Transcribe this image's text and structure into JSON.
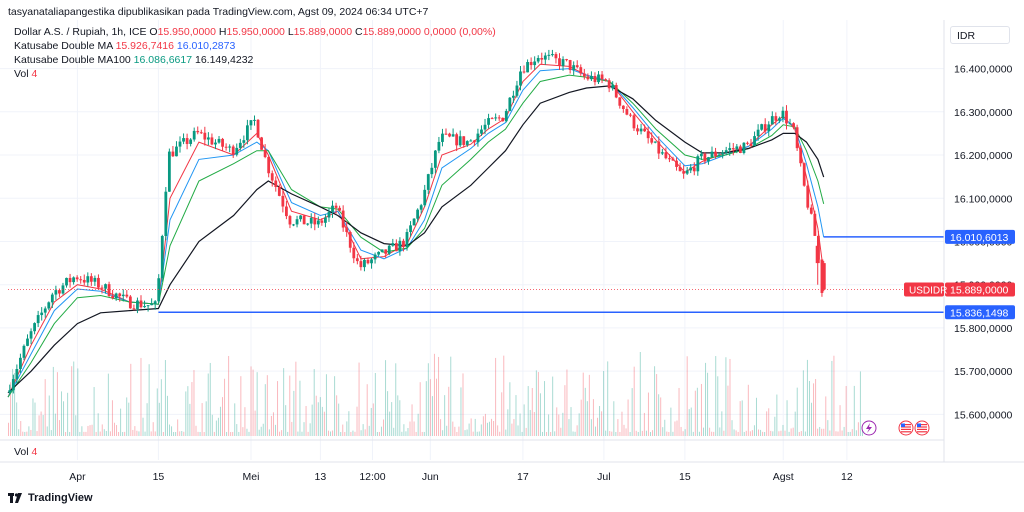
{
  "header": {
    "publisher_line": "tasyanataliapangestika dipublikasikan pada TradingView.com, Agst 09, 2024 06:34 UTC+7",
    "symbol": "Dollar A.S. / Rupiah, 1h, ICE",
    "o_label": "O",
    "o_val": "15.950,0000",
    "h_label": "H",
    "h_val": "15.950,0000",
    "l_label": "L",
    "l_val": "15.889,0000",
    "c_label": "C",
    "c_val": "15.889,0000",
    "change": "0,0000 (0,00%)",
    "ma1_name": "Katusabe Double MA",
    "ma1_v1": "15.926,7416",
    "ma1_v2": "16.010,2873",
    "ma2_name": "Katusabe Double MA100",
    "ma2_v1": "16.086,6617",
    "ma2_v2": "16.149,4232",
    "vol_label": "Vol",
    "vol_val": "4"
  },
  "currency": "IDR",
  "bottom_vol": {
    "label": "Vol",
    "value": "4"
  },
  "brand": "TradingView",
  "colors": {
    "up": "#089981",
    "down": "#f23645",
    "hline": "#2962ff",
    "ma_red": "#f23645",
    "ma_blue": "#2196f3",
    "ma_green": "#22ab45",
    "ma_black": "#131722"
  },
  "chart_data": {
    "type": "candlestick",
    "ylim": [
      15550,
      16480
    ],
    "y_ticks": [
      15600,
      15700,
      15800,
      15900,
      16000,
      16100,
      16200,
      16300,
      16400
    ],
    "y_tick_labels": [
      "15.600,0000",
      "15.700,0000",
      "15.800,0000",
      "15.900,0000",
      "16.000,0000",
      "16.100,0000",
      "16.200,0000",
      "16.300,0000",
      "16.400,0000"
    ],
    "x_labels": [
      {
        "label": "Apr",
        "date": "2024-04-01"
      },
      {
        "label": "15",
        "date": "2024-04-15"
      },
      {
        "label": "Mei",
        "date": "2024-05-01"
      },
      {
        "label": "13",
        "date": "2024-05-13"
      },
      {
        "label": "12:00",
        "date": "2024-05-22"
      },
      {
        "label": "Jun",
        "date": "2024-06-01"
      },
      {
        "label": "17",
        "date": "2024-06-17"
      },
      {
        "label": "Jul",
        "date": "2024-07-01"
      },
      {
        "label": "15",
        "date": "2024-07-15"
      },
      {
        "label": "Agst",
        "date": "2024-08-01"
      },
      {
        "label": "12",
        "date": "2024-08-12"
      }
    ],
    "x_range": [
      "2024-03-20",
      "2024-08-16"
    ],
    "price_path": [
      {
        "date": "2024-03-20",
        "price": 15650
      },
      {
        "date": "2024-03-24",
        "price": 15780
      },
      {
        "date": "2024-03-28",
        "price": 15880
      },
      {
        "date": "2024-04-01",
        "price": 15920
      },
      {
        "date": "2024-04-05",
        "price": 15900
      },
      {
        "date": "2024-04-10",
        "price": 15860
      },
      {
        "date": "2024-04-15",
        "price": 15850
      },
      {
        "date": "2024-04-17",
        "price": 16200
      },
      {
        "date": "2024-04-22",
        "price": 16250
      },
      {
        "date": "2024-04-28",
        "price": 16210
      },
      {
        "date": "2024-05-02",
        "price": 16280
      },
      {
        "date": "2024-05-04",
        "price": 16180
      },
      {
        "date": "2024-05-08",
        "price": 16050
      },
      {
        "date": "2024-05-13",
        "price": 16040
      },
      {
        "date": "2024-05-16",
        "price": 16080
      },
      {
        "date": "2024-05-20",
        "price": 15940
      },
      {
        "date": "2024-05-24",
        "price": 15970
      },
      {
        "date": "2024-05-28",
        "price": 16000
      },
      {
        "date": "2024-05-31",
        "price": 16100
      },
      {
        "date": "2024-06-03",
        "price": 16240
      },
      {
        "date": "2024-06-08",
        "price": 16230
      },
      {
        "date": "2024-06-11",
        "price": 16270
      },
      {
        "date": "2024-06-14",
        "price": 16290
      },
      {
        "date": "2024-06-17",
        "price": 16400
      },
      {
        "date": "2024-06-20",
        "price": 16430
      },
      {
        "date": "2024-06-25",
        "price": 16410
      },
      {
        "date": "2024-06-28",
        "price": 16380
      },
      {
        "date": "2024-07-02",
        "price": 16370
      },
      {
        "date": "2024-07-06",
        "price": 16280
      },
      {
        "date": "2024-07-10",
        "price": 16220
      },
      {
        "date": "2024-07-15",
        "price": 16150
      },
      {
        "date": "2024-07-18",
        "price": 16190
      },
      {
        "date": "2024-07-22",
        "price": 16210
      },
      {
        "date": "2024-07-26",
        "price": 16220
      },
      {
        "date": "2024-07-30",
        "price": 16280
      },
      {
        "date": "2024-08-01",
        "price": 16300
      },
      {
        "date": "2024-08-03",
        "price": 16260
      },
      {
        "date": "2024-08-05",
        "price": 16120
      },
      {
        "date": "2024-08-07",
        "price": 16000
      },
      {
        "date": "2024-08-08",
        "price": 15889
      }
    ],
    "moving_averages": [
      {
        "color": "ma_red",
        "values": [
          15640,
          15760,
          15860,
          15900,
          15890,
          15860,
          15855,
          16100,
          16230,
          16200,
          16250,
          16200,
          16070,
          16050,
          16070,
          15960,
          15965,
          15995,
          16080,
          16200,
          16225,
          16260,
          16285,
          16370,
          16410,
          16405,
          16385,
          16370,
          16300,
          16235,
          16160,
          16185,
          16205,
          16220,
          16270,
          16290,
          16260,
          16150,
          16030,
          15927
        ]
      },
      {
        "color": "ma_blue",
        "values": [
          15640,
          15740,
          15840,
          15890,
          15885,
          15860,
          15855,
          16050,
          16190,
          16200,
          16230,
          16210,
          16090,
          16060,
          16070,
          15980,
          15960,
          15985,
          16050,
          16170,
          16215,
          16250,
          16275,
          16350,
          16395,
          16400,
          16385,
          16370,
          16310,
          16245,
          16175,
          16180,
          16200,
          16220,
          16260,
          16285,
          16265,
          16180,
          16080,
          16010
        ]
      },
      {
        "color": "ma_green",
        "values": [
          15640,
          15720,
          15810,
          15870,
          15875,
          15860,
          15855,
          15990,
          16140,
          16180,
          16210,
          16210,
          16120,
          16080,
          16075,
          16010,
          15975,
          15985,
          16030,
          16130,
          16190,
          16230,
          16260,
          16320,
          16370,
          16385,
          16380,
          16370,
          16320,
          16260,
          16200,
          16190,
          16200,
          16215,
          16245,
          16270,
          16265,
          16210,
          16140,
          16087
        ]
      },
      {
        "color": "ma_black",
        "values": [
          15650,
          15700,
          15760,
          15810,
          15835,
          15840,
          15845,
          15900,
          16000,
          16060,
          16120,
          16140,
          16110,
          16080,
          16060,
          16020,
          15995,
          15990,
          16020,
          16080,
          16130,
          16170,
          16210,
          16270,
          16320,
          16345,
          16355,
          16360,
          16330,
          16280,
          16230,
          16205,
          16205,
          16215,
          16235,
          16250,
          16250,
          16230,
          16190,
          16149
        ]
      }
    ],
    "volume_seed": 7,
    "horizontal_levels": [
      {
        "value": 16010.6013,
        "label": "16.010,6013",
        "start_date": "2024-08-08"
      },
      {
        "value": 15836.1498,
        "label": "15.836,1498",
        "start_date": "2024-04-15"
      }
    ],
    "current_price": {
      "value": 15889,
      "symbol": "USDIDR",
      "label": "15.889,0000"
    }
  }
}
